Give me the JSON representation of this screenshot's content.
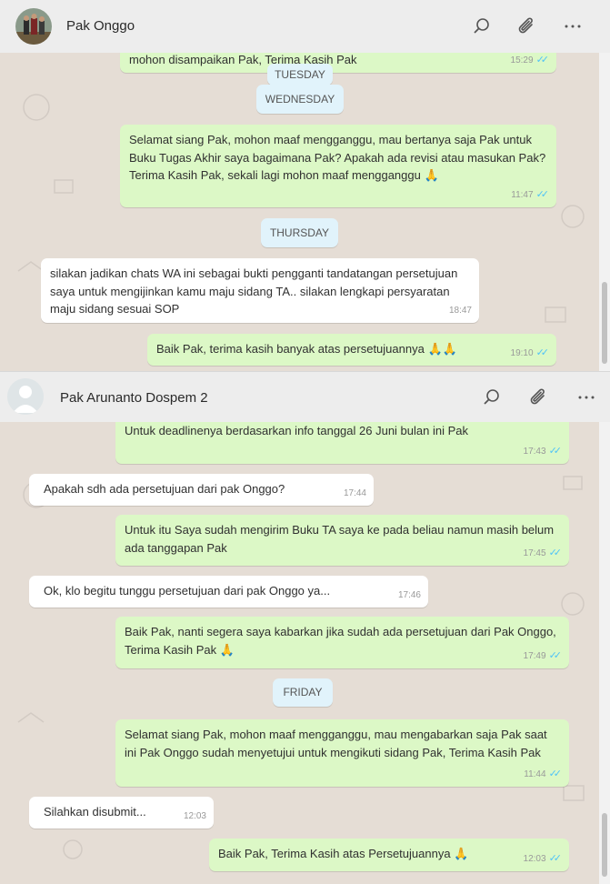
{
  "top": {
    "contact": "Pak Onggo",
    "messages": [
      {
        "text": "mohon disampaikan Pak, Terima Kasih Pak",
        "time": "15:29"
      },
      {
        "text": "Selamat siang Pak, mohon maaf mengganggu, mau bertanya saja Pak untuk Buku Tugas Akhir saya bagaimana Pak? Apakah ada revisi atau masukan Pak? Terima Kasih Pak, sekali lagi mohon maaf mengganggu 🙏",
        "time": "11:47"
      },
      {
        "text": "silakan jadikan chats WA ini sebagai bukti pengganti tandatangan persetujuan saya untuk mengijinkan kamu maju sidang TA.. silakan lengkapi persyaratan maju sidang sesuai SOP",
        "time": "18:47"
      },
      {
        "text": "Baik Pak, terima kasih banyak atas persetujuannya 🙏🙏",
        "time": "19:10"
      }
    ],
    "days": [
      "TUESDAY",
      "WEDNESDAY",
      "THURSDAY"
    ]
  },
  "bottom": {
    "contact": "Pak Arunanto Dospem 2",
    "messages": [
      {
        "text": "Untuk deadlinenya berdasarkan info tanggal 26 Juni bulan ini Pak",
        "time": "17:43"
      },
      {
        "text": "Apakah sdh ada persetujuan dari pak Onggo?",
        "time": "17:44"
      },
      {
        "text": "Untuk itu Saya sudah mengirim Buku TA saya ke pada beliau namun masih belum ada tanggapan Pak",
        "time": "17:45"
      },
      {
        "text": "Ok, klo begitu tunggu persetujuan dari pak Onggo ya...",
        "time": "17:46"
      },
      {
        "text": "Baik Pak, nanti segera saya kabarkan jika sudah ada persetujuan dari Pak Onggo, Terima Kasih Pak 🙏",
        "time": "17:49"
      },
      {
        "text": "Selamat siang Pak, mohon maaf mengganggu, mau mengabarkan saja Pak saat ini Pak Onggo sudah menyetujui untuk mengikuti sidang Pak, Terima Kasih Pak",
        "time": "11:44"
      },
      {
        "text": "Silahkan disubmit...",
        "time": "12:03"
      },
      {
        "text": "Baik Pak, Terima Kasih atas Persetujuannya 🙏",
        "time": "12:03"
      }
    ],
    "days": [
      "FRIDAY"
    ]
  },
  "icons": {
    "search": "search-icon",
    "attach": "paperclip-icon",
    "menu": "more-horizontal-icon"
  },
  "colors": {
    "outgoing": "#dcf8c6",
    "incoming": "#ffffff",
    "header": "#ededed",
    "day_badge": "#e1f3fb",
    "ticks": "#4fc3f7"
  }
}
